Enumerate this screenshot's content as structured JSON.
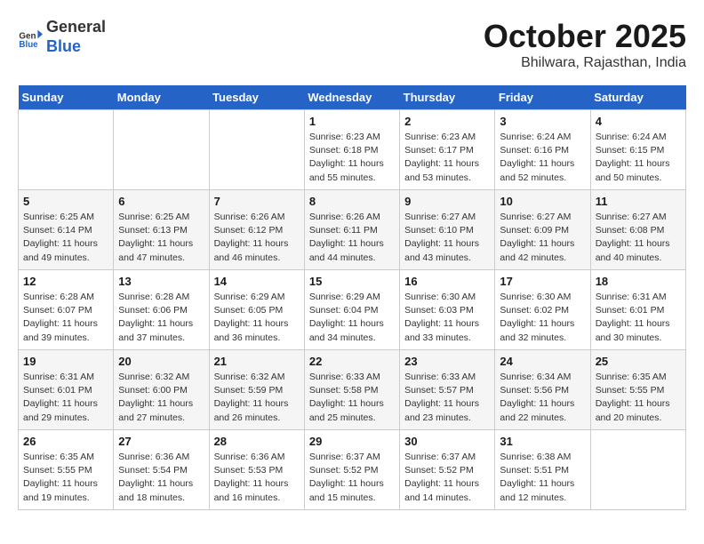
{
  "header": {
    "logo_line1": "General",
    "logo_line2": "Blue",
    "month": "October 2025",
    "location": "Bhilwara, Rajasthan, India"
  },
  "days_of_week": [
    "Sunday",
    "Monday",
    "Tuesday",
    "Wednesday",
    "Thursday",
    "Friday",
    "Saturday"
  ],
  "weeks": [
    [
      {
        "day": "",
        "info": ""
      },
      {
        "day": "",
        "info": ""
      },
      {
        "day": "",
        "info": ""
      },
      {
        "day": "1",
        "info": "Sunrise: 6:23 AM\nSunset: 6:18 PM\nDaylight: 11 hours\nand 55 minutes."
      },
      {
        "day": "2",
        "info": "Sunrise: 6:23 AM\nSunset: 6:17 PM\nDaylight: 11 hours\nand 53 minutes."
      },
      {
        "day": "3",
        "info": "Sunrise: 6:24 AM\nSunset: 6:16 PM\nDaylight: 11 hours\nand 52 minutes."
      },
      {
        "day": "4",
        "info": "Sunrise: 6:24 AM\nSunset: 6:15 PM\nDaylight: 11 hours\nand 50 minutes."
      }
    ],
    [
      {
        "day": "5",
        "info": "Sunrise: 6:25 AM\nSunset: 6:14 PM\nDaylight: 11 hours\nand 49 minutes."
      },
      {
        "day": "6",
        "info": "Sunrise: 6:25 AM\nSunset: 6:13 PM\nDaylight: 11 hours\nand 47 minutes."
      },
      {
        "day": "7",
        "info": "Sunrise: 6:26 AM\nSunset: 6:12 PM\nDaylight: 11 hours\nand 46 minutes."
      },
      {
        "day": "8",
        "info": "Sunrise: 6:26 AM\nSunset: 6:11 PM\nDaylight: 11 hours\nand 44 minutes."
      },
      {
        "day": "9",
        "info": "Sunrise: 6:27 AM\nSunset: 6:10 PM\nDaylight: 11 hours\nand 43 minutes."
      },
      {
        "day": "10",
        "info": "Sunrise: 6:27 AM\nSunset: 6:09 PM\nDaylight: 11 hours\nand 42 minutes."
      },
      {
        "day": "11",
        "info": "Sunrise: 6:27 AM\nSunset: 6:08 PM\nDaylight: 11 hours\nand 40 minutes."
      }
    ],
    [
      {
        "day": "12",
        "info": "Sunrise: 6:28 AM\nSunset: 6:07 PM\nDaylight: 11 hours\nand 39 minutes."
      },
      {
        "day": "13",
        "info": "Sunrise: 6:28 AM\nSunset: 6:06 PM\nDaylight: 11 hours\nand 37 minutes."
      },
      {
        "day": "14",
        "info": "Sunrise: 6:29 AM\nSunset: 6:05 PM\nDaylight: 11 hours\nand 36 minutes."
      },
      {
        "day": "15",
        "info": "Sunrise: 6:29 AM\nSunset: 6:04 PM\nDaylight: 11 hours\nand 34 minutes."
      },
      {
        "day": "16",
        "info": "Sunrise: 6:30 AM\nSunset: 6:03 PM\nDaylight: 11 hours\nand 33 minutes."
      },
      {
        "day": "17",
        "info": "Sunrise: 6:30 AM\nSunset: 6:02 PM\nDaylight: 11 hours\nand 32 minutes."
      },
      {
        "day": "18",
        "info": "Sunrise: 6:31 AM\nSunset: 6:01 PM\nDaylight: 11 hours\nand 30 minutes."
      }
    ],
    [
      {
        "day": "19",
        "info": "Sunrise: 6:31 AM\nSunset: 6:01 PM\nDaylight: 11 hours\nand 29 minutes."
      },
      {
        "day": "20",
        "info": "Sunrise: 6:32 AM\nSunset: 6:00 PM\nDaylight: 11 hours\nand 27 minutes."
      },
      {
        "day": "21",
        "info": "Sunrise: 6:32 AM\nSunset: 5:59 PM\nDaylight: 11 hours\nand 26 minutes."
      },
      {
        "day": "22",
        "info": "Sunrise: 6:33 AM\nSunset: 5:58 PM\nDaylight: 11 hours\nand 25 minutes."
      },
      {
        "day": "23",
        "info": "Sunrise: 6:33 AM\nSunset: 5:57 PM\nDaylight: 11 hours\nand 23 minutes."
      },
      {
        "day": "24",
        "info": "Sunrise: 6:34 AM\nSunset: 5:56 PM\nDaylight: 11 hours\nand 22 minutes."
      },
      {
        "day": "25",
        "info": "Sunrise: 6:35 AM\nSunset: 5:55 PM\nDaylight: 11 hours\nand 20 minutes."
      }
    ],
    [
      {
        "day": "26",
        "info": "Sunrise: 6:35 AM\nSunset: 5:55 PM\nDaylight: 11 hours\nand 19 minutes."
      },
      {
        "day": "27",
        "info": "Sunrise: 6:36 AM\nSunset: 5:54 PM\nDaylight: 11 hours\nand 18 minutes."
      },
      {
        "day": "28",
        "info": "Sunrise: 6:36 AM\nSunset: 5:53 PM\nDaylight: 11 hours\nand 16 minutes."
      },
      {
        "day": "29",
        "info": "Sunrise: 6:37 AM\nSunset: 5:52 PM\nDaylight: 11 hours\nand 15 minutes."
      },
      {
        "day": "30",
        "info": "Sunrise: 6:37 AM\nSunset: 5:52 PM\nDaylight: 11 hours\nand 14 minutes."
      },
      {
        "day": "31",
        "info": "Sunrise: 6:38 AM\nSunset: 5:51 PM\nDaylight: 11 hours\nand 12 minutes."
      },
      {
        "day": "",
        "info": ""
      }
    ]
  ]
}
